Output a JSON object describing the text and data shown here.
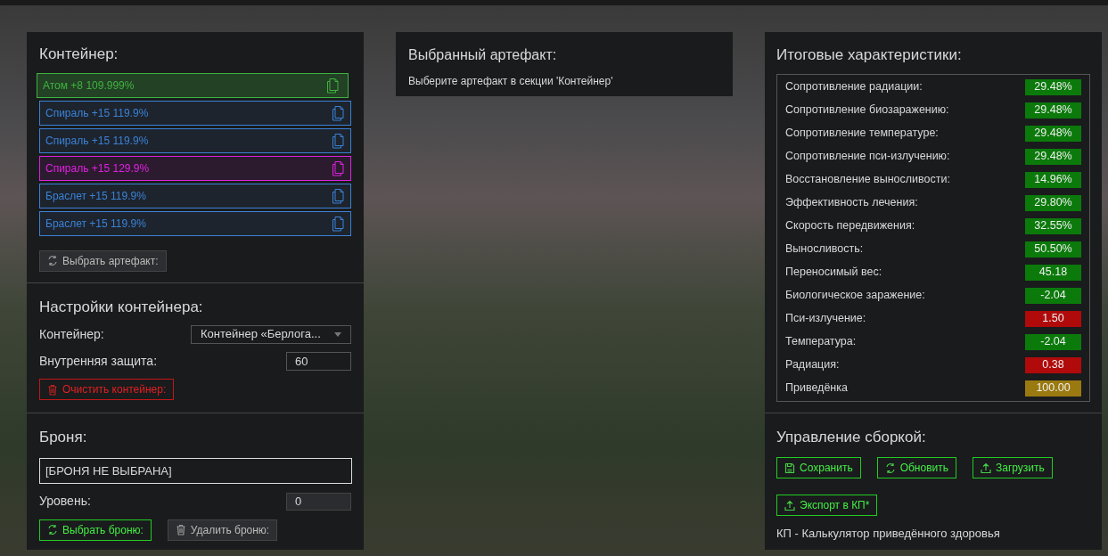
{
  "container": {
    "title": "Контейнер:",
    "artifacts": [
      {
        "label": "Атом +8 109.999%",
        "color": "#3fb33f",
        "selected": true
      },
      {
        "label": "Спираль +15 119.9%",
        "color": "#3b82d6",
        "selected": false
      },
      {
        "label": "Спираль +15 119.9%",
        "color": "#3b82d6",
        "selected": false
      },
      {
        "label": "Спираль +15 129.9%",
        "color": "#e020e0",
        "selected": false
      },
      {
        "label": "Браслет +15 119.9%",
        "color": "#3b82d6",
        "selected": false
      },
      {
        "label": "Браслет +15 119.9%",
        "color": "#3b82d6",
        "selected": false
      }
    ],
    "button": {
      "label": "Выбрать артефакт:",
      "kind": "pick"
    }
  },
  "container_settings": {
    "title": "Настройки контейнера:",
    "container_label": "Контейнер:",
    "container_value": "Контейнер «Берлога...",
    "protection_label": "Внутренняя защита:",
    "protection_value": "60",
    "button": {
      "label": "Очистить контейнер:",
      "kind": "clear"
    }
  },
  "armor": {
    "title": "Броня:",
    "value": "[БРОНЯ НЕ ВЫБРАНА]",
    "level_label": "Уровень:",
    "level_value": "0",
    "buttons": [
      {
        "label": "Выбрать броню:",
        "kind": "choose"
      },
      {
        "label": "Удалить броню:",
        "kind": "remove"
      }
    ]
  },
  "selected_artifact": {
    "title": "Выбранный артефакт:",
    "hint": "Выберите артефакт в секции 'Контейнер'"
  },
  "totals": {
    "title": "Итоговые характеристики:",
    "stats": [
      {
        "label": "Сопротивление радиации:",
        "value": "29.48%",
        "color": "#0b7a0b"
      },
      {
        "label": "Сопротивление биозаражению:",
        "value": "29.48%",
        "color": "#0b7a0b"
      },
      {
        "label": "Сопротивление температуре:",
        "value": "29.48%",
        "color": "#0b7a0b"
      },
      {
        "label": "Сопротивление пси-излучению:",
        "value": "29.48%",
        "color": "#0b7a0b"
      },
      {
        "label": "Восстановление выносливости:",
        "value": "14.96%",
        "color": "#0b7a0b"
      },
      {
        "label": "Эффективность лечения:",
        "value": "29.80%",
        "color": "#0b7a0b"
      },
      {
        "label": "Скорость передвижения:",
        "value": "32.55%",
        "color": "#0b7a0b"
      },
      {
        "label": "Выносливость:",
        "value": "50.50%",
        "color": "#0b7a0b"
      },
      {
        "label": "Переносимый вес:",
        "value": "45.18",
        "color": "#0b7a0b"
      },
      {
        "label": "Биологическое заражение:",
        "value": "-2.04",
        "color": "#0b7a0b"
      },
      {
        "label": "Пси-излучение:",
        "value": "1.50",
        "color": "#b00a0a"
      },
      {
        "label": "Температура:",
        "value": "-2.04",
        "color": "#0b7a0b"
      },
      {
        "label": "Радиация:",
        "value": "0.38",
        "color": "#b00a0a"
      },
      {
        "label": "Приведёнка",
        "value": "100.00",
        "color": "#9a7a10"
      }
    ]
  },
  "build": {
    "title": "Управление сборкой:",
    "buttons": [
      {
        "label": "Сохранить",
        "kind": "save"
      },
      {
        "label": "Обновить",
        "kind": "refresh"
      },
      {
        "label": "Загрузить",
        "kind": "upload"
      },
      {
        "label": "Экспорт в КП*",
        "kind": "export"
      }
    ],
    "note": "КП - Калькулятор приведённого здоровья"
  }
}
